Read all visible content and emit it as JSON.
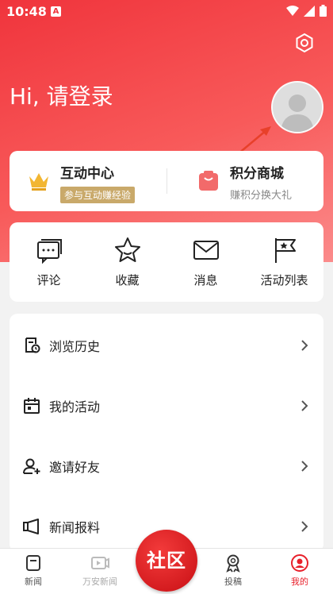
{
  "status_bar": {
    "time": "10:48",
    "sim_label": "A"
  },
  "header": {
    "greeting": "Hi, 请登录"
  },
  "feature_card": {
    "interaction": {
      "title": "互动中心",
      "badge": "参与互动赚经验"
    },
    "points_mall": {
      "title": "积分商城",
      "subtitle": "赚积分换大礼"
    }
  },
  "quick_actions": [
    {
      "label": "评论",
      "icon": "comment-icon"
    },
    {
      "label": "收藏",
      "icon": "star-icon"
    },
    {
      "label": "消息",
      "icon": "mail-icon"
    },
    {
      "label": "活动列表",
      "icon": "flag-icon"
    }
  ],
  "menu_items": [
    {
      "label": "浏览历史",
      "icon": "history-icon"
    },
    {
      "label": "我的活动",
      "icon": "calendar-icon"
    },
    {
      "label": "邀请好友",
      "icon": "add-user-icon"
    },
    {
      "label": "新闻报料",
      "icon": "video-icon"
    }
  ],
  "tabs": [
    {
      "label": "新闻",
      "icon": "news-icon",
      "state": "normal"
    },
    {
      "label": "万安新闻",
      "icon": "play-icon",
      "state": "disabled"
    },
    {
      "label": "社区",
      "icon": "community-button",
      "state": "center"
    },
    {
      "label": "投稿",
      "icon": "award-icon",
      "state": "normal"
    },
    {
      "label": "我的",
      "icon": "profile-icon",
      "state": "active"
    }
  ],
  "colors": {
    "brand_red": "#e8202b",
    "gold": "#c9a96a"
  }
}
